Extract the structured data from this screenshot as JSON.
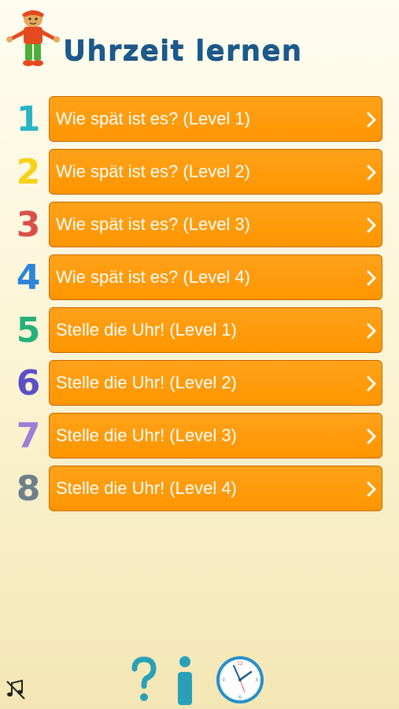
{
  "app": {
    "title": "Uhrzeit lernen"
  },
  "menu": [
    {
      "number": "1",
      "label": "Wie spät ist es? (Level 1)",
      "color": "#2ab5c6"
    },
    {
      "number": "2",
      "label": "Wie spät ist es? (Level 2)",
      "color": "#f5d11a"
    },
    {
      "number": "3",
      "label": "Wie spät ist es? (Level 3)",
      "color": "#d9504a"
    },
    {
      "number": "4",
      "label": "Wie spät ist es? (Level 4)",
      "color": "#2f86d9"
    },
    {
      "number": "5",
      "label": "Stelle die Uhr! (Level 1)",
      "color": "#26b07a"
    },
    {
      "number": "6",
      "label": "Stelle die Uhr! (Level 2)",
      "color": "#5a4fc6"
    },
    {
      "number": "7",
      "label": "Stelle die Uhr! (Level 3)",
      "color": "#9a7fd6"
    },
    {
      "number": "8",
      "label": "Stelle die Uhr! (Level 4)",
      "color": "#6c7f8a"
    }
  ],
  "footer": {
    "icons": [
      "music-off-icon",
      "help-icon",
      "info-icon",
      "clock-icon"
    ]
  },
  "colors": {
    "button": "#ff9500",
    "button_border": "#c66a00",
    "title": "#1a5a8c",
    "footer_icon": "#2aa0b8"
  }
}
